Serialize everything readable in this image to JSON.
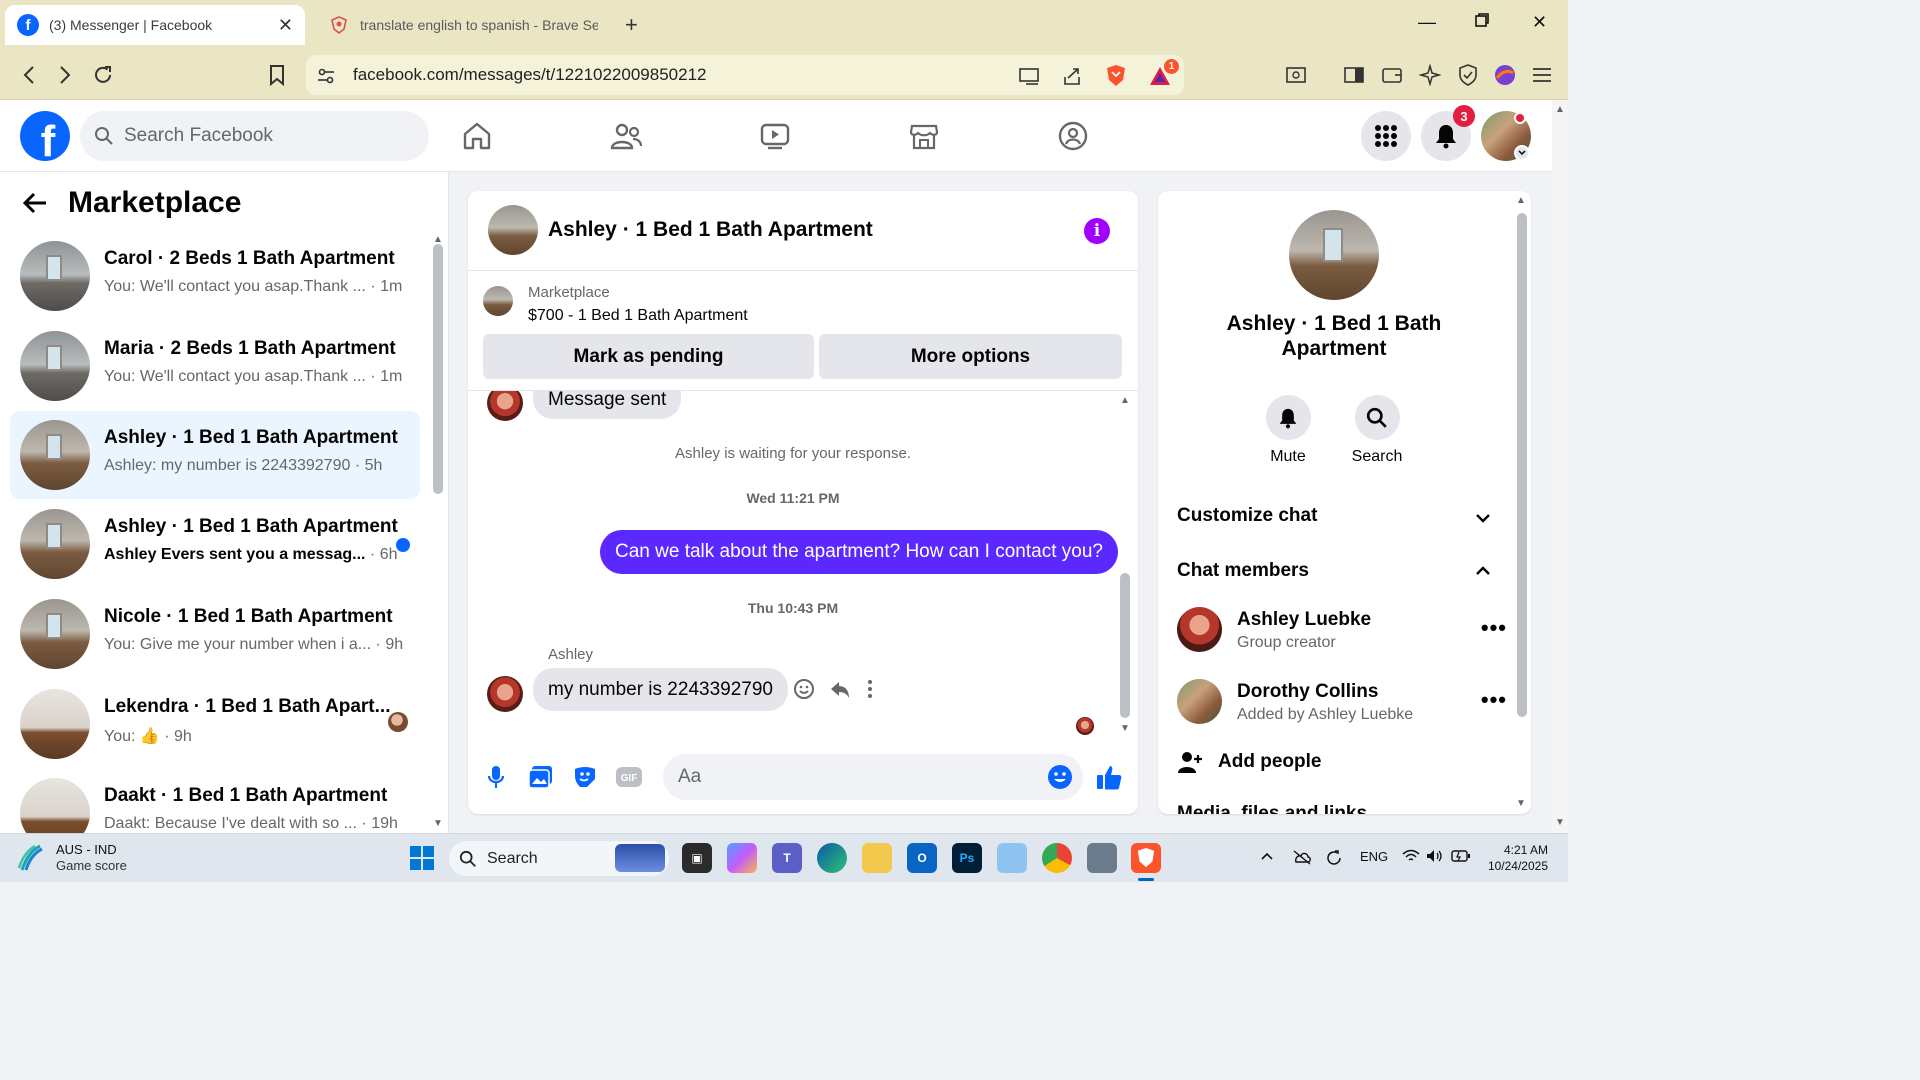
{
  "browser": {
    "tabs": [
      {
        "title": "(3) Messenger | Facebook",
        "active": true
      },
      {
        "title": "translate english to spanish - Brave Search",
        "active": false
      }
    ],
    "url": "facebook.com/messages/t/1221022009850212",
    "rewards_badge": "1"
  },
  "fb": {
    "search_placeholder": "Search Facebook",
    "notification_count": "3"
  },
  "sidebar": {
    "title": "Marketplace",
    "conversations": [
      {
        "name": "Carol · 2 Beds 1 Bath Apartment",
        "snippet": "You: We'll contact you asap.Thank ...",
        "time": " · 1m",
        "unread": false
      },
      {
        "name": "Maria · 2 Beds 1 Bath Apartment",
        "snippet": "You: We'll contact you asap.Thank ...",
        "time": " · 1m",
        "unread": false
      },
      {
        "name": "Ashley · 1 Bed 1 Bath Apartment",
        "snippet": "Ashley: my number is 2243392790",
        "time": " · 5h",
        "unread": false
      },
      {
        "name": "Ashley · 1 Bed 1 Bath Apartment",
        "snippet": "Ashley Evers sent you a messag...",
        "time": " · 6h",
        "unread": true
      },
      {
        "name": "Nicole · 1 Bed 1 Bath Apartment",
        "snippet": "You: Give me your number when i a...",
        "time": " · 9h",
        "unread": false
      },
      {
        "name": "Lekendra · 1 Bed 1 Bath Apart...",
        "snippet": "You: 👍",
        "time": " · 9h",
        "unread": false
      },
      {
        "name": "Daakt · 1 Bed 1 Bath Apartment",
        "snippet": "Daakt: Because I've dealt with so ...",
        "time": " · 19h",
        "unread": false
      }
    ]
  },
  "chat": {
    "title": "Ashley · 1 Bed 1 Bath Apartment",
    "listing_label": "Marketplace",
    "listing_price": "$700 - 1 Bed 1 Bath Apartment",
    "mark_pending": "Mark as pending",
    "more_options": "More options",
    "prev_message": "Message sent",
    "waiting": "Ashley is waiting for your response.",
    "ts1": "Wed 11:21 PM",
    "outgoing": "Can we talk about the apartment? How can I contact you?",
    "ts2": "Thu 10:43 PM",
    "sender": "Ashley",
    "incoming": "my number is 2243392790",
    "input_placeholder": "Aa"
  },
  "details": {
    "name": "Ashley · 1 Bed 1 Bath Apartment",
    "mute": "Mute",
    "search": "Search",
    "customize": "Customize chat",
    "members_title": "Chat members",
    "members": [
      {
        "name": "Ashley Luebke",
        "sub": "Group creator"
      },
      {
        "name": "Dorothy Collins",
        "sub": "Added by Ashley Luebke"
      }
    ],
    "add_people": "Add people",
    "media": "Media, files and links"
  },
  "taskbar": {
    "weather_title": "AUS - IND",
    "weather_sub": "Game score",
    "search": "Search",
    "lang": "ENG",
    "time": "4:21 AM",
    "date": "10/24/2025"
  },
  "colors": {
    "fb_blue": "#0866ff",
    "message_purple": "#5b28ff",
    "info_purple": "#a100ff",
    "badge_red": "#e41e3f",
    "chrome_bg": "#eae6c4"
  }
}
